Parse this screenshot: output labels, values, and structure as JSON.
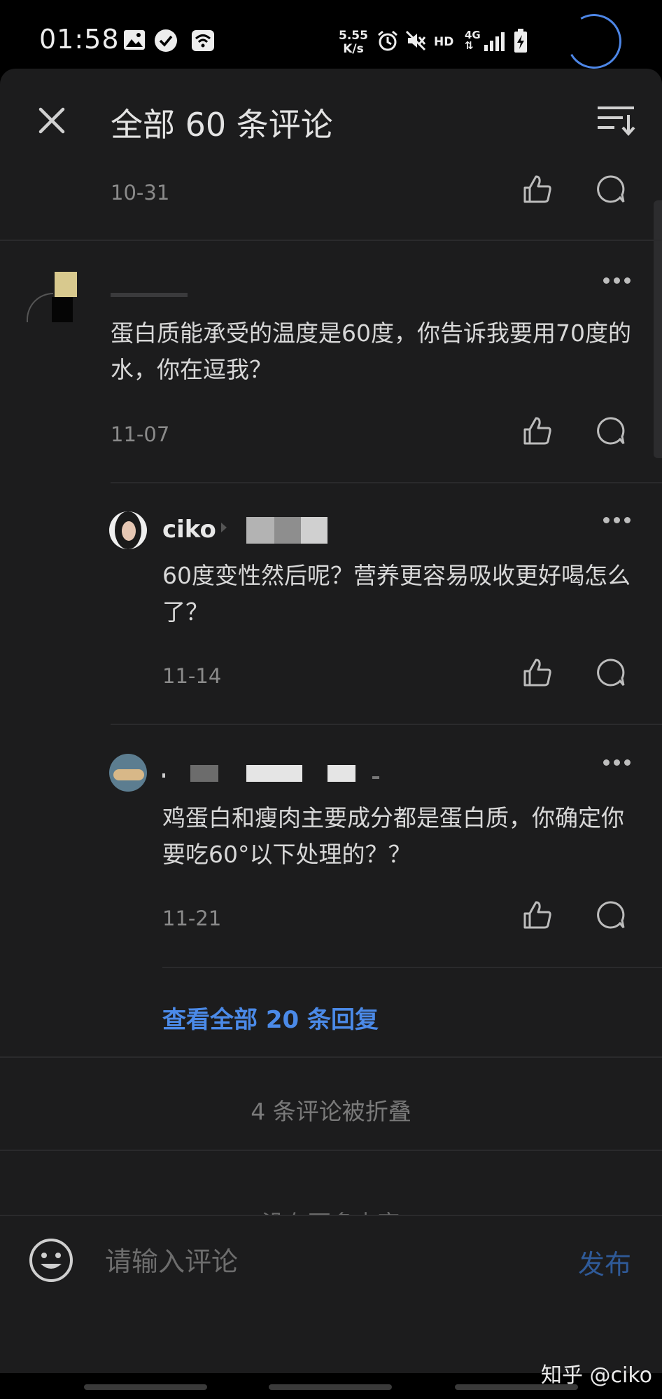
{
  "status_bar": {
    "time": "01:58",
    "net_speed_value": "5.55",
    "net_speed_unit": "K/s",
    "hd_label": "HD",
    "network_label": "4G",
    "icons": [
      "image-icon",
      "check-badge-icon",
      "wifi-icon",
      "alarm-icon",
      "mute-icon",
      "signal-icon",
      "battery-charging-icon"
    ]
  },
  "header": {
    "title": "全部 60 条评论",
    "close_icon": "close-icon",
    "sort_icon": "sort-icon"
  },
  "comments": [
    {
      "date": "10-31"
    },
    {
      "text": "蛋白质能承受的温度是60度，你告诉我要用70度的水，你在逗我？",
      "date": "11-07"
    }
  ],
  "replies": [
    {
      "username": "ciko",
      "text": "60度变性然后呢？营养更容易吸收更好喝怎么了？",
      "date": "11-14"
    },
    {
      "text": "鸡蛋白和瘦肉主要成分都是蛋白质，你确定你要吃60°以下处理的？？",
      "date": "11-21"
    }
  ],
  "view_all_replies": "查看全部 20 条回复",
  "folded_notice": "4 条评论被折叠",
  "end_notice": "没有更多内容",
  "input_bar": {
    "placeholder": "请输入评论",
    "publish_label": "发布",
    "emoji_icon": "emoji-icon"
  },
  "watermark": "知乎 @ciko",
  "colors": {
    "accent": "#4b8ae8",
    "background": "#1c1c1d",
    "publish": "#2f5a98"
  }
}
